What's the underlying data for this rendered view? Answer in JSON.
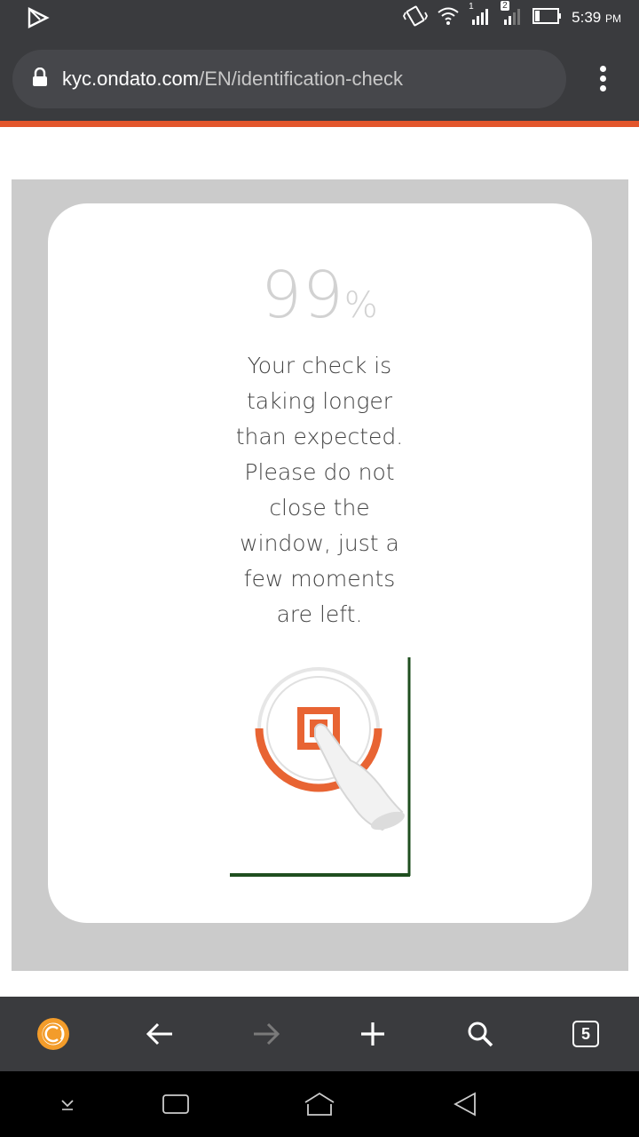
{
  "status_bar": {
    "time": "5:39",
    "ampm": "PM",
    "sim1_label": "1",
    "sim2_label": "2",
    "icons": [
      "play-store-icon",
      "vibrate-icon",
      "wifi-icon",
      "signal-icon",
      "signal-icon",
      "battery-icon"
    ]
  },
  "browser": {
    "url_domain": "kyc.ondato.com",
    "url_path": "/EN/identification-check",
    "tab_count": "5",
    "accent_color": "#e2562c"
  },
  "page": {
    "progress_number": "99",
    "progress_symbol": "%",
    "progress_value": 0.99,
    "message_lines": [
      "Your check is",
      "taking longer",
      "than expected.",
      "Please do not",
      "close the",
      "window, just a",
      "few moments",
      "are left."
    ]
  },
  "toolbar": {
    "icons": [
      "browser-logo-icon",
      "back-arrow-icon",
      "forward-arrow-icon",
      "new-tab-plus-icon",
      "search-icon",
      "tabs-count-icon"
    ]
  },
  "navbar": {
    "icons": [
      "hide-keyboard-icon",
      "recents-icon",
      "home-icon",
      "back-icon"
    ]
  }
}
